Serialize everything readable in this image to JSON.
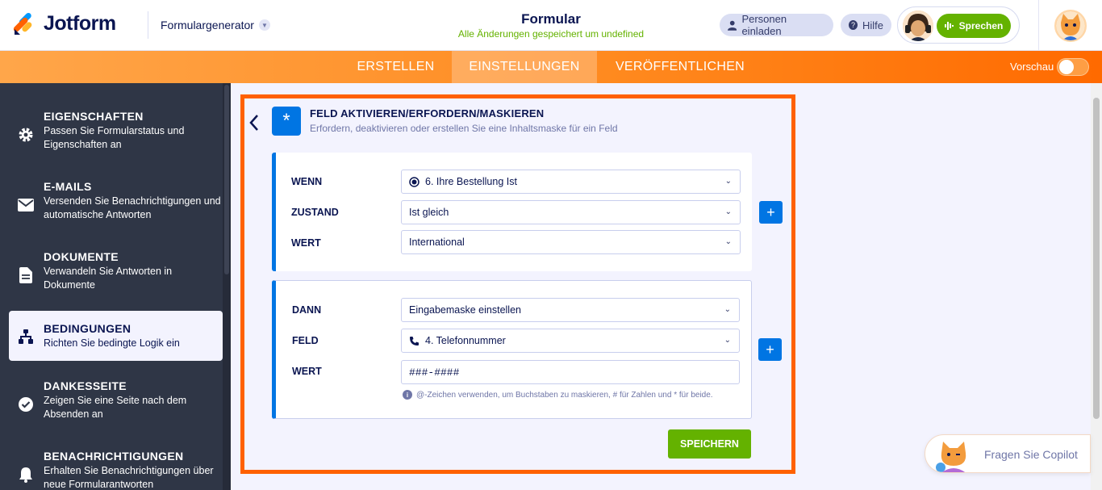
{
  "header": {
    "logo_text": "Jotform",
    "builder_label": "Formulargenerator",
    "form_title": "Formular",
    "save_status": "Alle Änderungen gespeichert um undefined",
    "invite_label": "Personen einladen",
    "help_label": "Hilfe",
    "speak_label": "Sprechen"
  },
  "nav": {
    "tabs": [
      {
        "label": "ERSTELLEN"
      },
      {
        "label": "EINSTELLUNGEN"
      },
      {
        "label": "VERÖFFENTLICHEN"
      }
    ],
    "active_tab": "EINSTELLUNGEN",
    "preview_label": "Vorschau",
    "preview_on": false
  },
  "sidebar": {
    "items": [
      {
        "title": "EIGENSCHAFTEN",
        "desc": "Passen Sie Formularstatus und Eigenschaften an",
        "icon": "gear-icon"
      },
      {
        "title": "E-MAILS",
        "desc": "Versenden Sie Benachrichtigungen und automatische Antworten",
        "icon": "envelope-icon"
      },
      {
        "title": "DOKUMENTE",
        "desc": "Verwandeln Sie Antworten in Dokumente",
        "icon": "document-icon"
      },
      {
        "title": "BEDINGUNGEN",
        "desc": "Richten Sie bedingte Logik ein",
        "icon": "sitemap-icon"
      },
      {
        "title": "DANKESSEITE",
        "desc": "Zeigen Sie eine Seite nach dem Absenden an",
        "icon": "check-circle-icon"
      },
      {
        "title": "BENACHRICHTIGUNGEN",
        "desc": "Erhalten Sie Benachrichtigungen über neue Formularantworten",
        "icon": "bell-icon"
      }
    ],
    "active_item": "BEDINGUNGEN"
  },
  "condition": {
    "title": "FELD AKTIVIEREN/ERFORDERN/MASKIEREN",
    "description": "Erfordern, deaktivieren oder erstellen Sie eine Inhaltsmaske für ein Feld",
    "if_block": {
      "if_label": "WENN",
      "if_value": "6. Ihre Bestellung Ist",
      "state_label": "ZUSTAND",
      "state_value": "Ist gleich",
      "value_label": "WERT",
      "value_value": "International"
    },
    "then_block": {
      "then_label": "DANN",
      "then_value": "Eingabemaske einstellen",
      "field_label": "FELD",
      "field_value": "4. Telefonnummer",
      "value_label": "WERT",
      "value_value": "###-####",
      "hint": "@-Zeichen verwenden, um Buchstaben zu maskieren, # für Zahlen und * für beide."
    },
    "save_label": "SPEICHERN"
  },
  "copilot": {
    "label": "Fragen Sie Copilot"
  },
  "colors": {
    "accent_blue": "#0075e3",
    "accent_orange": "#ff6100",
    "save_green": "#64b200",
    "sidebar_bg": "#2f3646"
  }
}
